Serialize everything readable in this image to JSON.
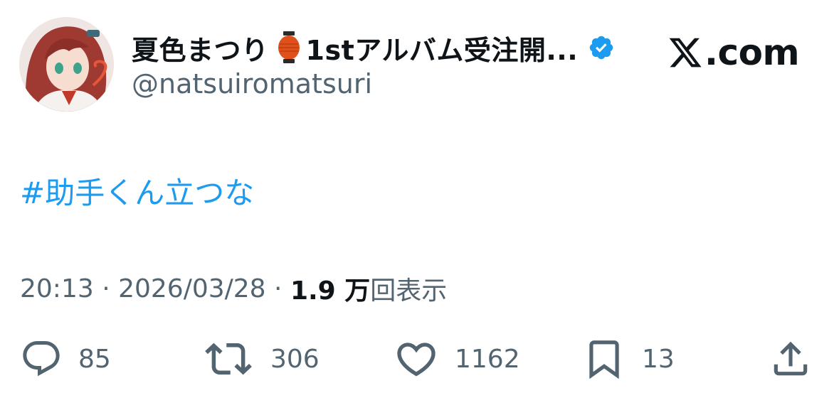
{
  "header": {
    "display_name": "夏色まつり",
    "display_name_suffix": "1stアルバム受注開...",
    "handle": "@natsuiromatsuri",
    "site_logo_text": ".com",
    "site_logo_icon": "x-logo-icon",
    "verified_icon": "verified-badge-icon",
    "lantern_icon": "red-lantern-emoji-icon"
  },
  "tweet": {
    "text": "#助手くん立つな"
  },
  "meta": {
    "time": "20:13",
    "separator1": " · ",
    "date": "2026/03/28",
    "separator2": " · ",
    "views_count": "1.9 万",
    "views_label": "回表示"
  },
  "actions": {
    "reply_count": "85",
    "retweet_count": "306",
    "like_count": "1162",
    "bookmark_count": "13",
    "icons": [
      "reply-icon",
      "retweet-icon",
      "like-icon",
      "bookmark-icon",
      "share-icon"
    ]
  },
  "colors": {
    "link": "#1d9bf0",
    "secondary_text": "#536471",
    "primary_text": "#0f1419",
    "verified": "#1d9bf0",
    "lantern": "#e0501a"
  }
}
